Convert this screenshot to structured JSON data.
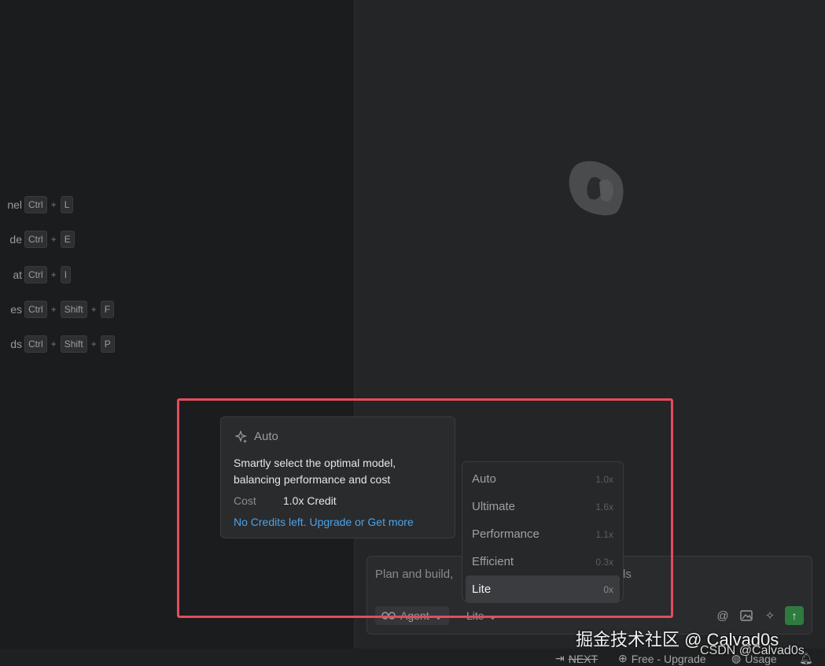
{
  "shortcuts": [
    {
      "label": "nel",
      "keys": [
        "Ctrl",
        "L"
      ]
    },
    {
      "label": "de",
      "keys": [
        "Ctrl",
        "E"
      ]
    },
    {
      "label": "at",
      "keys": [
        "Ctrl",
        "I"
      ]
    },
    {
      "label": "es",
      "keys": [
        "Ctrl",
        "Shift",
        "F"
      ]
    },
    {
      "label": "ds",
      "keys": [
        "Ctrl",
        "Shift",
        "P"
      ]
    }
  ],
  "tooltip": {
    "icon": "sparkle-star-icon",
    "title": "Auto",
    "description": "Smartly select the optimal model, balancing performance and cost",
    "cost_label": "Cost",
    "cost_value": "1.0x Credit",
    "link_text": "No Credits left. Upgrade or Get more"
  },
  "model_dropdown": {
    "items": [
      {
        "name": "Auto",
        "multiplier": "1.0x"
      },
      {
        "name": "Ultimate",
        "multiplier": "1.6x"
      },
      {
        "name": "Performance",
        "multiplier": "1.1x"
      },
      {
        "name": "Efficient",
        "multiplier": "0.3x"
      },
      {
        "name": "Lite",
        "multiplier": "0x"
      }
    ],
    "selected": "Lite"
  },
  "chat": {
    "placeholder": "Plan and build,",
    "placeholder_tail": "ds",
    "agent_label": "Agent",
    "model_label": "Lite"
  },
  "status_bar": {
    "next_label": "NEXT",
    "plan_label": "Free - Upgrade",
    "usage_label": "Usage"
  },
  "watermark": {
    "main": "掘金技术社区 @ Calvad0s",
    "secondary": "CSDN @Calvad0s"
  },
  "colors": {
    "highlight": "#e34d5c",
    "link": "#4aa3e8",
    "send": "#2f7a3f"
  }
}
